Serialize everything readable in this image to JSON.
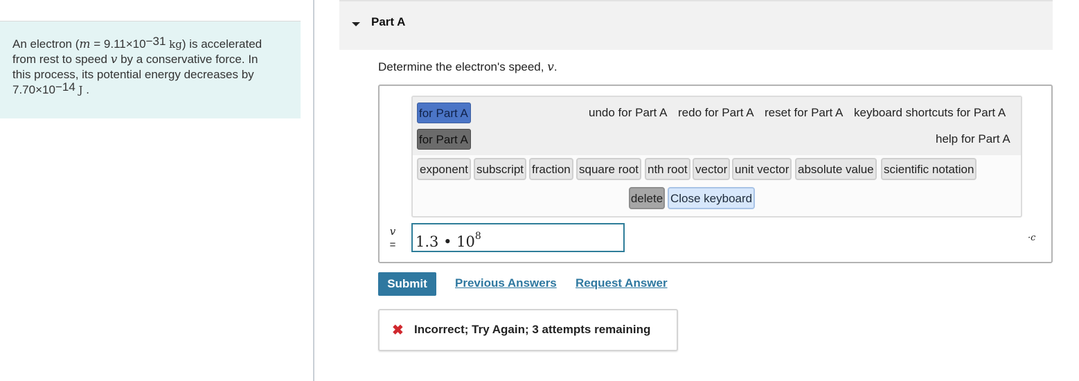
{
  "problem": {
    "t1": "An electron (",
    "m_symbol": "m",
    "t2": " = 9.11×10",
    "mass_exp": "−31",
    "mass_unit": "kg",
    "t3": ") is accelerated",
    "t4": "from rest to speed ",
    "v_symbol": "v",
    "t5": " by a conservative force. In",
    "t6": "this process, its potential energy decreases by",
    "t7": "7.70×10",
    "energy_exp": "−14",
    "energy_unit": "J",
    "t8": "."
  },
  "part": {
    "title": "Part A"
  },
  "question": {
    "text": "Determine the electron's speed, ",
    "var": "v",
    "end": "."
  },
  "toolbar": {
    "templates_label": "for Part A",
    "symbols_label": "for Part A",
    "undo_label": "undo for Part A",
    "redo_label": "redo for Part A",
    "reset_label": "reset for Part A",
    "shortcuts_label": "keyboard shortcuts for Part A",
    "help_label": "help for Part A"
  },
  "keyboard": {
    "keys": [
      "exponent",
      "subscript",
      "fraction",
      "square root",
      "nth root",
      "vector",
      "unit vector",
      "absolute value",
      "scientific notation"
    ],
    "delete_label": "delete",
    "close_label": "Close keyboard"
  },
  "answer": {
    "var": "v",
    "eq": "=",
    "mantissa": "1.3 • 10",
    "exponent": "8",
    "unit": "·c"
  },
  "actions": {
    "submit_label": "Submit",
    "previous_answers_label": "Previous Answers",
    "request_answer_label": "Request Answer"
  },
  "feedback": {
    "icon": "✖",
    "text": "Incorrect; Try Again; 3 attempts remaining"
  },
  "colors": {
    "problem_bg": "#e4f4f4",
    "accent": "#2f78a0",
    "error": "#d0282e"
  }
}
